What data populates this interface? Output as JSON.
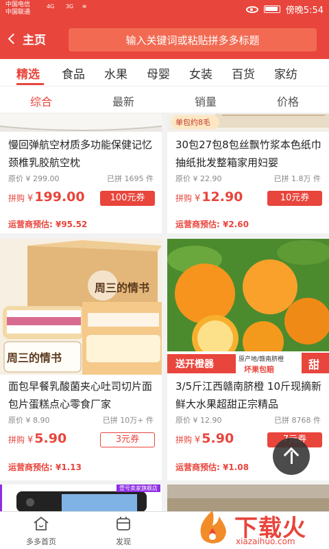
{
  "status_bar": {
    "carrier1": "中国电信",
    "carrier2": "中国联通",
    "net1": "4G",
    "net2": "3G",
    "time": "傍晚5:54"
  },
  "header": {
    "back_label": "主页",
    "search_placeholder": "输入关键词或粘贴拼多多标题"
  },
  "categories": [
    "精选",
    "食品",
    "水果",
    "母婴",
    "女装",
    "百货",
    "家纺"
  ],
  "active_category": "精选",
  "sort_options": [
    "综合",
    "最新",
    "销量",
    "价格"
  ],
  "active_sort": "综合",
  "products": [
    {
      "title": "慢回弹航空材质多功能保健记忆颈椎乳胶航空枕",
      "original_price": "原价 ¥ 299.00",
      "sold": "已拼 1695 件",
      "pin_label": "拼购",
      "yen": "¥",
      "price": "199.00",
      "coupon": "100元券",
      "estimate": "运营商预估: ¥95.52"
    },
    {
      "title": "30包27包8包丝飘竹浆本色纸巾抽纸批发整箱家用妇婴",
      "original_price": "原价 ¥ 22.90",
      "sold": "已拼 1.8万 件",
      "pin_label": "拼购",
      "yen": "¥",
      "price": "12.90",
      "coupon": "10元券",
      "estimate": "运营商预估: ¥2.60",
      "img_badge": "单包约8毛"
    },
    {
      "title": "面包早餐乳酸菌夹心吐司切片面包片蛋糕点心零食厂家",
      "original_price": "原价 ¥ 8.90",
      "sold": "已拼 10万+ 件",
      "pin_label": "拼购",
      "yen": "¥",
      "price": "5.90",
      "coupon": "3元券",
      "estimate": "运营商预估: ¥1.13",
      "img_text": "周三的情书"
    },
    {
      "title": "3/5斤江西赣南脐橙 10斤现摘新鲜大水果超甜正宗精品",
      "original_price": "原价 ¥ 12.90",
      "sold": "已拼 8768 件",
      "pin_label": "拼购",
      "yen": "¥",
      "price": "5.90",
      "coupon": "7元券",
      "estimate": "运营商预估: ¥1.08",
      "img_banner": "送开橙器",
      "img_origin": "原产地/赣南脐橙",
      "img_guarantee": "坏果包赔",
      "img_tag": "甜"
    }
  ],
  "partial_cards": {
    "store_badge": "壹号卖家旗舰店"
  },
  "bottom_tabs": [
    {
      "label": "多多首页",
      "icon": "home-icon"
    },
    {
      "label": "发现",
      "icon": "discover-icon"
    }
  ],
  "watermark": {
    "text": "下载火",
    "url": "xiazaihuo.com"
  },
  "colors": {
    "brand": "#e8453c",
    "text": "#222222",
    "muted": "#888888"
  }
}
